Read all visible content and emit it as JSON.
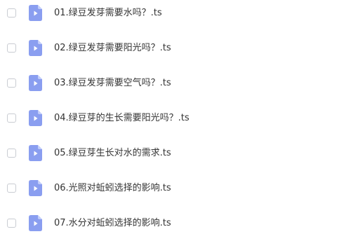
{
  "files": [
    {
      "name": "01.绿豆发芽需要水吗？.ts"
    },
    {
      "name": "02.绿豆发芽需要阳光吗？.ts"
    },
    {
      "name": "03.绿豆发芽需要空气吗？.ts"
    },
    {
      "name": "04.绿豆芽的生长需要阳光吗？.ts"
    },
    {
      "name": "05.绿豆芽生长对水的需求.ts"
    },
    {
      "name": "06.光照对蚯蚓选择的影响.ts"
    },
    {
      "name": "07.水分对蚯蚓选择的影响.ts"
    }
  ],
  "colors": {
    "icon_fill": "#8A9EF0",
    "icon_fold": "#C3CEFA",
    "text": "#333333",
    "checkbox_border": "#C9CCD2"
  },
  "icons": {
    "file": "video-file-icon"
  }
}
